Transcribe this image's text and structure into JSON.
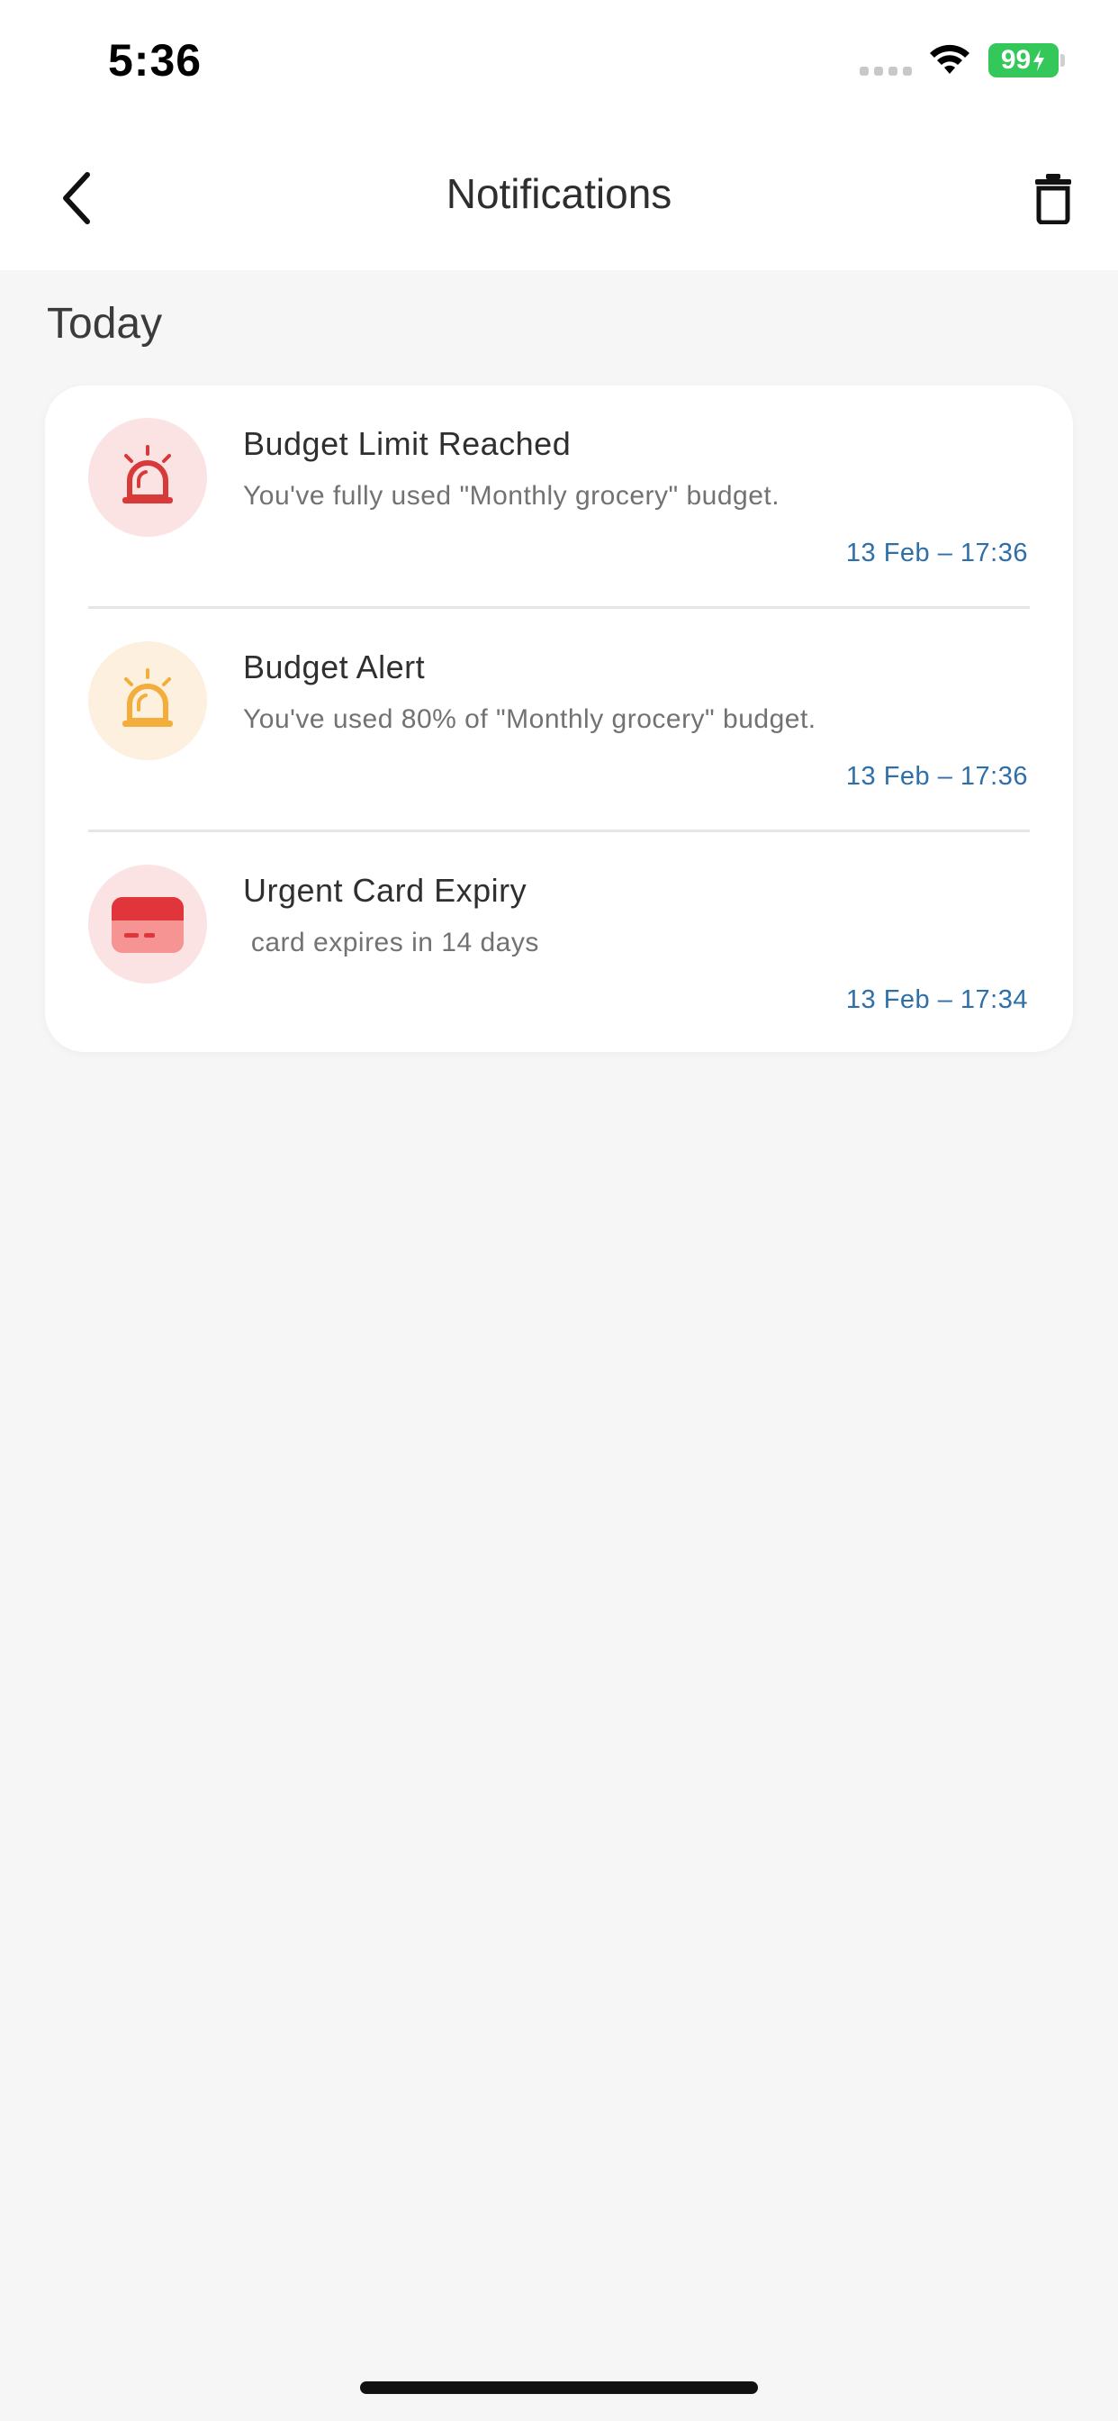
{
  "status_bar": {
    "time": "5:36",
    "battery": "99",
    "colors": {
      "battery": "#34c759"
    },
    "icons": [
      "signal-icon",
      "wifi-icon",
      "charging-battery-icon"
    ]
  },
  "nav": {
    "title": "Notifications",
    "back_icon": "chevron-left-icon",
    "delete_icon": "trash-icon"
  },
  "section": {
    "title": "Today"
  },
  "notifications": [
    {
      "title": "Budget Limit Reached",
      "body": "You've fully used \"Monthly grocery\" budget.",
      "time": "13 Feb – 17:36",
      "icon": "alarm-siren-icon",
      "colors": {
        "icon": "#d83a3a",
        "bg": "#fbe3e3"
      }
    },
    {
      "title": "Budget Alert",
      "body": "You've used 80% of \"Monthly grocery\" budget.",
      "time": "13 Feb – 17:36",
      "icon": "alarm-siren-icon",
      "colors": {
        "icon": "#f2ad3a",
        "bg": "#fdf0df"
      }
    },
    {
      "title": "Urgent Card Expiry",
      "body": " card expires in 14 days",
      "time": "13 Feb – 17:34",
      "icon": "credit-card-icon",
      "colors": {
        "icon": "#e8504f",
        "bg": "#fbe3e3"
      }
    }
  ],
  "colors": {
    "time_text": "#2e6ea9",
    "background": "#f6f6f6",
    "card": "#ffffff"
  }
}
